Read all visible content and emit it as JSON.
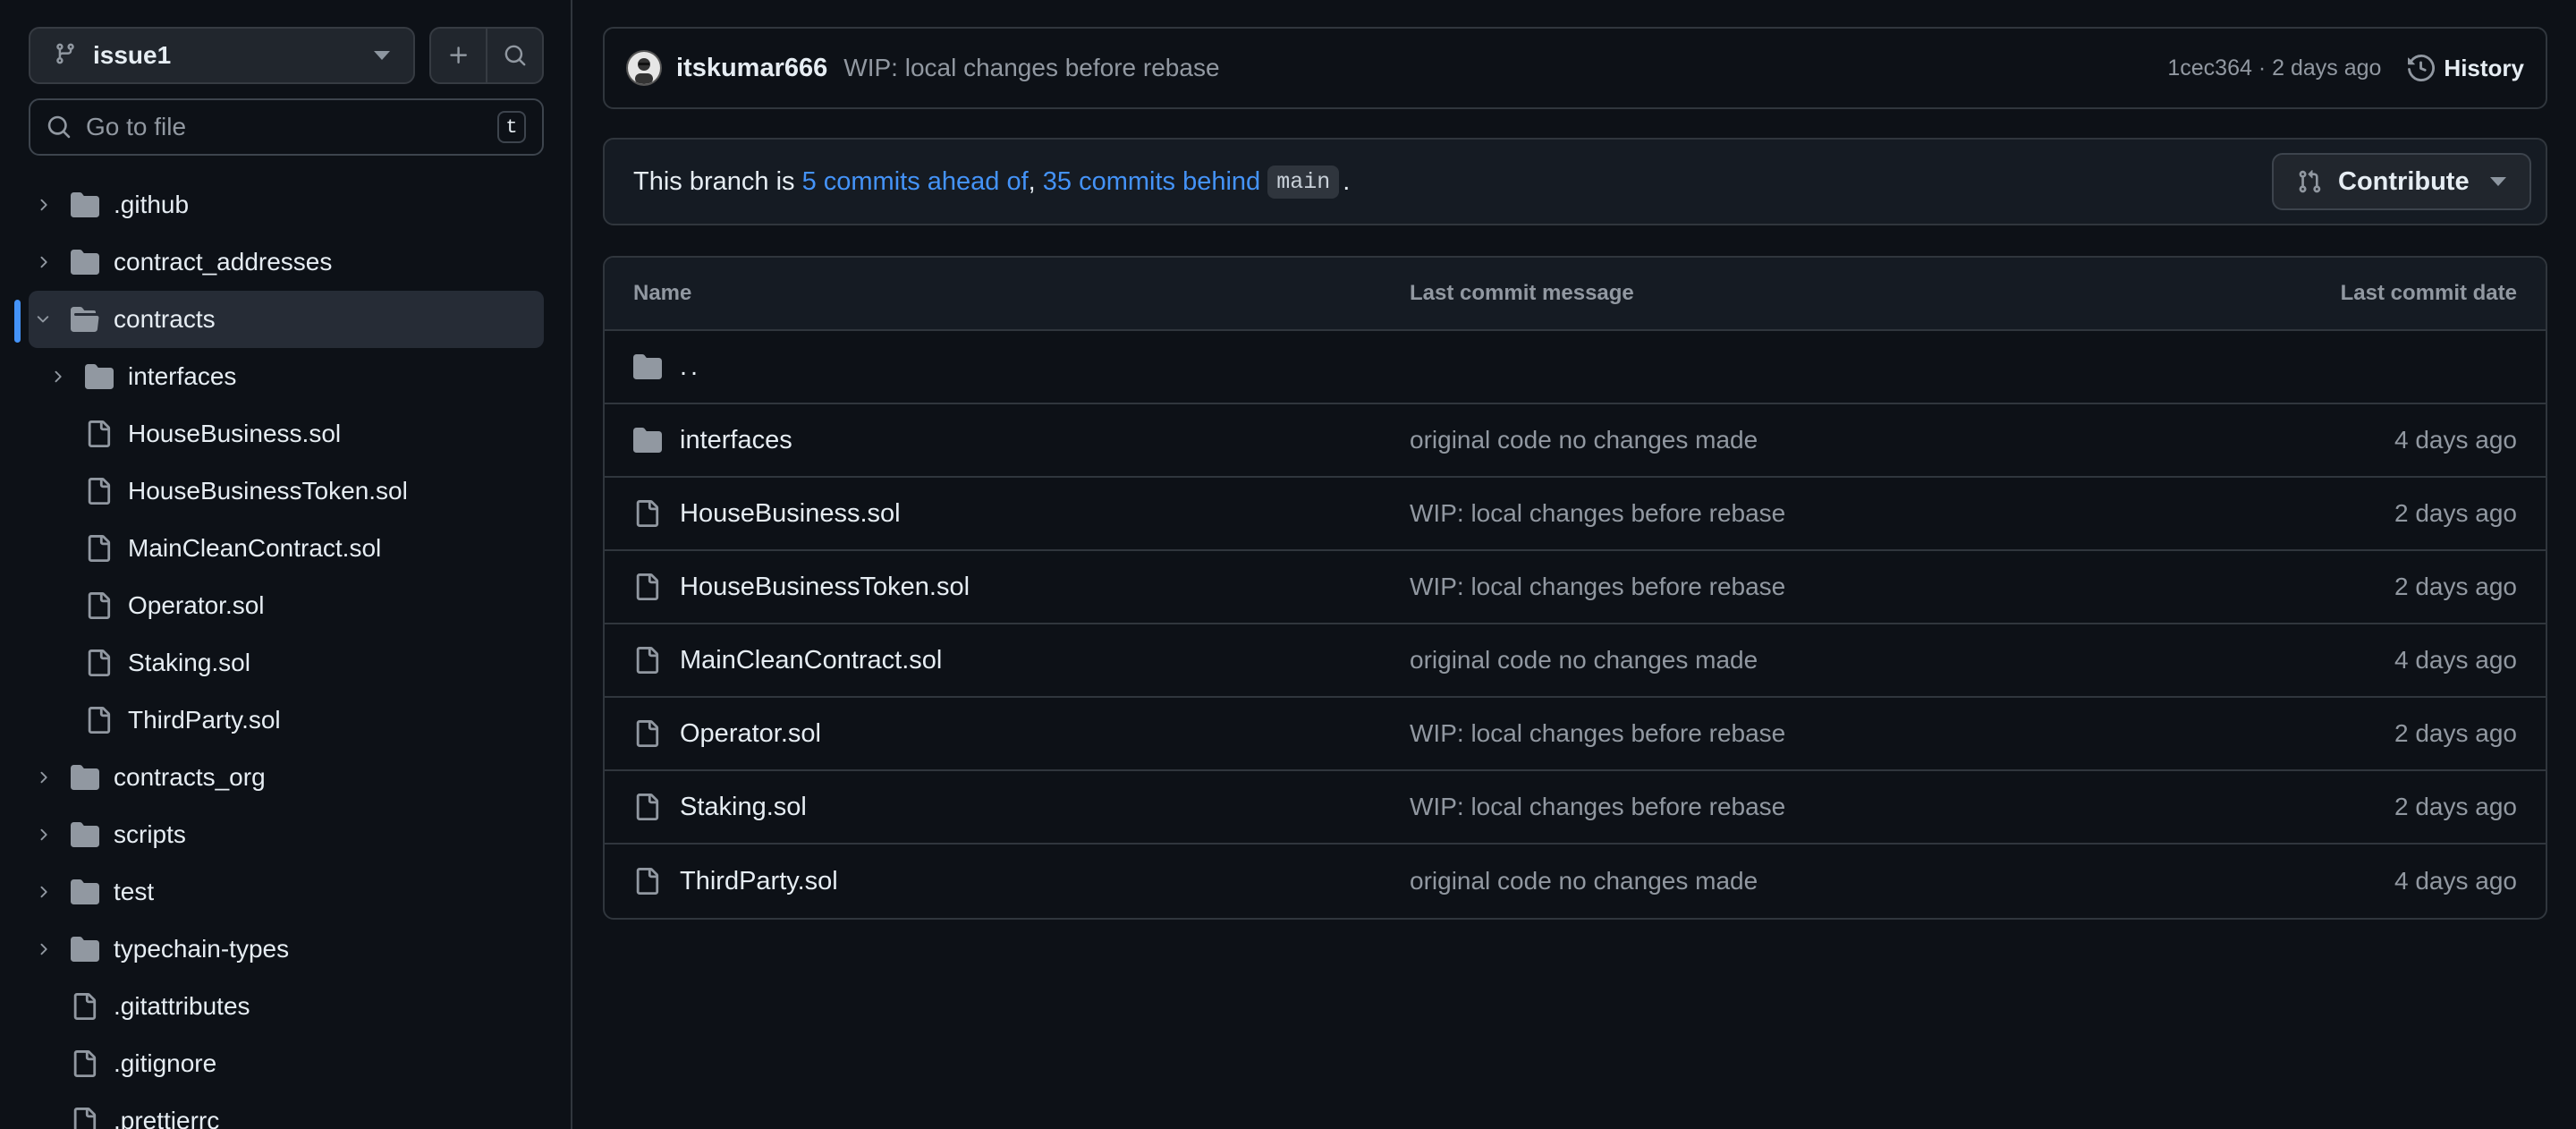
{
  "sidebar": {
    "branch": "issue1",
    "goto_placeholder": "Go to file",
    "goto_shortcut": "t",
    "tree": [
      {
        "label": ".github",
        "type": "folder",
        "depth": 0,
        "expanded": false
      },
      {
        "label": "contract_addresses",
        "type": "folder",
        "depth": 0,
        "expanded": false
      },
      {
        "label": "contracts",
        "type": "folder",
        "depth": 0,
        "expanded": true,
        "selected": true
      },
      {
        "label": "interfaces",
        "type": "folder",
        "depth": 1,
        "expanded": false
      },
      {
        "label": "HouseBusiness.sol",
        "type": "file",
        "depth": 1
      },
      {
        "label": "HouseBusinessToken.sol",
        "type": "file",
        "depth": 1
      },
      {
        "label": "MainCleanContract.sol",
        "type": "file",
        "depth": 1
      },
      {
        "label": "Operator.sol",
        "type": "file",
        "depth": 1
      },
      {
        "label": "Staking.sol",
        "type": "file",
        "depth": 1
      },
      {
        "label": "ThirdParty.sol",
        "type": "file",
        "depth": 1
      },
      {
        "label": "contracts_org",
        "type": "folder",
        "depth": 0,
        "expanded": false
      },
      {
        "label": "scripts",
        "type": "folder",
        "depth": 0,
        "expanded": false
      },
      {
        "label": "test",
        "type": "folder",
        "depth": 0,
        "expanded": false
      },
      {
        "label": "typechain-types",
        "type": "folder",
        "depth": 0,
        "expanded": false
      },
      {
        "label": ".gitattributes",
        "type": "file",
        "depth": 0
      },
      {
        "label": ".gitignore",
        "type": "file",
        "depth": 0
      },
      {
        "label": ".prettierrc",
        "type": "file",
        "depth": 0
      }
    ]
  },
  "commit": {
    "author": "itskumar666",
    "message": "WIP: local changes before rebase",
    "sha_time": "1cec364 · 2 days ago",
    "history_label": "History"
  },
  "branch_status": {
    "prefix": "This branch is ",
    "ahead": "5 commits ahead of",
    "separator": ", ",
    "behind": "35 commits behind",
    "base": "main",
    "suffix": ".",
    "contribute_label": "Contribute"
  },
  "files": {
    "headers": {
      "name": "Name",
      "message": "Last commit message",
      "date": "Last commit date"
    },
    "parent": "..",
    "rows": [
      {
        "name": "interfaces",
        "type": "folder",
        "message": "original code no changes made",
        "date": "4 days ago"
      },
      {
        "name": "HouseBusiness.sol",
        "type": "file",
        "message": "WIP: local changes before rebase",
        "date": "2 days ago"
      },
      {
        "name": "HouseBusinessToken.sol",
        "type": "file",
        "message": "WIP: local changes before rebase",
        "date": "2 days ago"
      },
      {
        "name": "MainCleanContract.sol",
        "type": "file",
        "message": "original code no changes made",
        "date": "4 days ago"
      },
      {
        "name": "Operator.sol",
        "type": "file",
        "message": "WIP: local changes before rebase",
        "date": "2 days ago"
      },
      {
        "name": "Staking.sol",
        "type": "file",
        "message": "WIP: local changes before rebase",
        "date": "2 days ago"
      },
      {
        "name": "ThirdParty.sol",
        "type": "file",
        "message": "original code no changes made",
        "date": "4 days ago"
      }
    ]
  },
  "colors": {
    "accent": "#4493f8",
    "background": "#0d1117",
    "muted": "#9198a1",
    "border": "#30363d"
  }
}
